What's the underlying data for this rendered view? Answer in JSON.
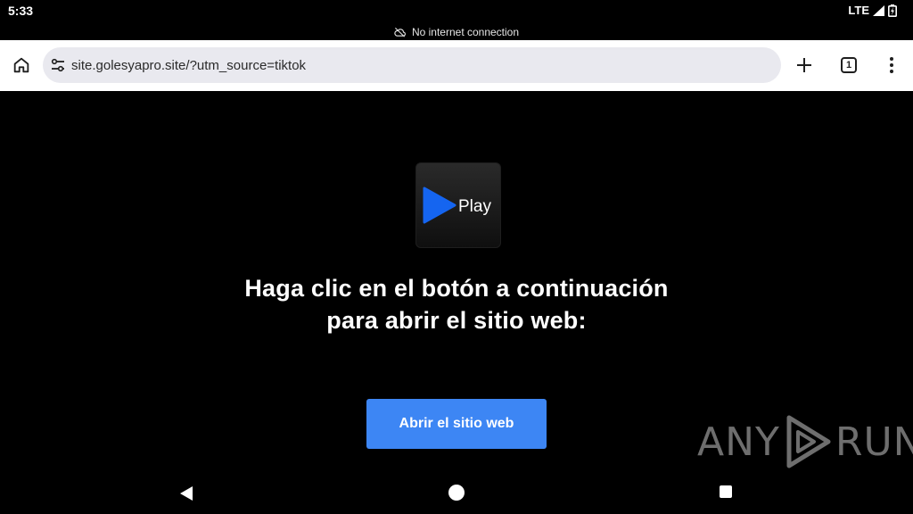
{
  "status_bar": {
    "time": "5:33",
    "network": "LTE"
  },
  "offline_notice": {
    "text": "No internet connection",
    "icon": "cloud-off-icon"
  },
  "toolbar": {
    "url": "site.golesyapro.site/?utm_source=tiktok",
    "tab_count": "1",
    "icons": [
      "home-icon",
      "tune-icon",
      "plus-icon",
      "tab-switcher-icon",
      "more-vert-icon"
    ]
  },
  "page": {
    "logo_text": "Play",
    "headline": "Haga clic en el botón a continuación para abrir el sitio web:",
    "button_label": "Abrir el sitio web",
    "accent_color": "#3d86f4",
    "logo_play_color": "#1565f0"
  },
  "watermark": {
    "left": "ANY",
    "right": "RUN"
  },
  "nav_bar": {
    "icons": [
      "back-icon",
      "home-circle-icon",
      "recents-icon"
    ]
  }
}
